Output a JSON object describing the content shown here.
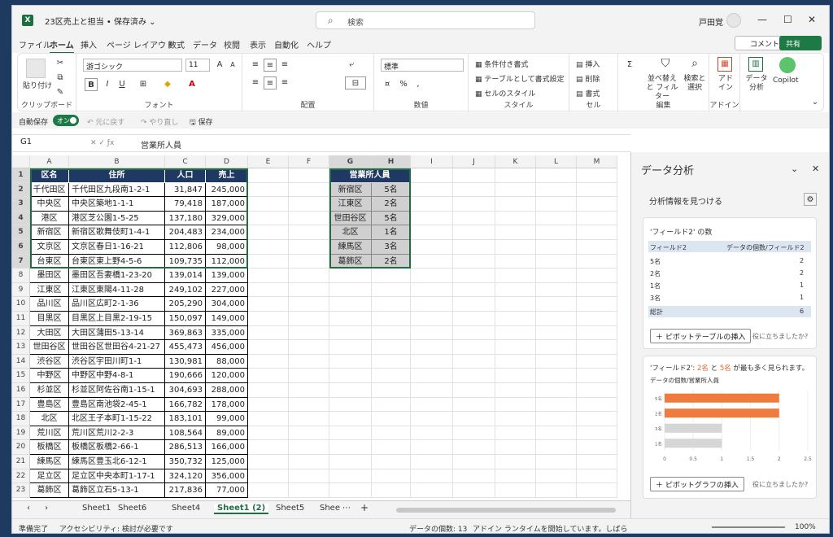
{
  "titlebar": {
    "app_icon": "X",
    "doc_title": "23区売上と担当 • 保存済み ⌄",
    "search": "検索",
    "user": "戸田覚"
  },
  "tabs": [
    "ファイル",
    "ホーム",
    "挿入",
    "ページ レイアウト",
    "数式",
    "データ",
    "校閲",
    "表示",
    "自動化",
    "ヘルプ"
  ],
  "comment": "コメント",
  "share": "共有",
  "ribbon": {
    "clipboard": "クリップボード",
    "paste": "貼り付け",
    "font": "フォント",
    "font_name": "游ゴシック",
    "font_size": "11",
    "align": "配置",
    "number": "数値",
    "number_format": "標準",
    "styles": "スタイル",
    "cond": "条件付き書式",
    "table": "テーブルとして書式設定",
    "cellstyle": "セルのスタイル",
    "cells": "セル",
    "insert": "挿入",
    "delete": "削除",
    "format": "書式",
    "edit": "編集",
    "sortfilter": "並べ替えと フィルター",
    "findsel": "検索と 選択",
    "addin": "アドイン",
    "addin_btn": "アド イン",
    "analyze": "データ 分析",
    "copilot": "Copilot"
  },
  "qat": {
    "autosave": "自動保存",
    "on": "オン",
    "undo": "元に戻す",
    "redo": "やり直し",
    "save": "保存"
  },
  "formula": {
    "namebox": "G1",
    "content": "営業所人員"
  },
  "columns": [
    "A",
    "B",
    "C",
    "D",
    "E",
    "F",
    "G",
    "H",
    "I",
    "J",
    "K",
    "L",
    "M"
  ],
  "table_header": [
    "区名",
    "住所",
    "人口",
    "売上"
  ],
  "rows": [
    [
      "千代田区",
      "千代田区九段南1-2-1",
      "31,847",
      "245,000"
    ],
    [
      "中央区",
      "中央区築地1-1-1",
      "79,418",
      "187,000"
    ],
    [
      "港区",
      "港区芝公園1-5-25",
      "137,180",
      "329,000"
    ],
    [
      "新宿区",
      "新宿区歌舞伎町1-4-1",
      "204,483",
      "234,000"
    ],
    [
      "文京区",
      "文京区春日1-16-21",
      "112,806",
      "98,000"
    ],
    [
      "台東区",
      "台東区東上野4-5-6",
      "109,735",
      "112,000"
    ],
    [
      "墨田区",
      "墨田区吾妻橋1-23-20",
      "139,014",
      "139,000"
    ],
    [
      "江東区",
      "江東区東陽4-11-28",
      "249,102",
      "227,000"
    ],
    [
      "品川区",
      "品川区広町2-1-36",
      "205,290",
      "304,000"
    ],
    [
      "目黒区",
      "目黒区上目黒2-19-15",
      "150,097",
      "149,000"
    ],
    [
      "大田区",
      "大田区蒲田5-13-14",
      "369,863",
      "335,000"
    ],
    [
      "世田谷区",
      "世田谷区世田谷4-21-27",
      "455,473",
      "456,000"
    ],
    [
      "渋谷区",
      "渋谷区宇田川町1-1",
      "130,981",
      "88,000"
    ],
    [
      "中野区",
      "中野区中野4-8-1",
      "190,666",
      "120,000"
    ],
    [
      "杉並区",
      "杉並区阿佐谷南1-15-1",
      "304,693",
      "288,000"
    ],
    [
      "豊島区",
      "豊島区南池袋2-45-1",
      "166,782",
      "178,000"
    ],
    [
      "北区",
      "北区王子本町1-15-22",
      "183,101",
      "99,000"
    ],
    [
      "荒川区",
      "荒川区荒川2-2-3",
      "108,564",
      "89,000"
    ],
    [
      "板橋区",
      "板橋区板橋2-66-1",
      "286,513",
      "166,000"
    ],
    [
      "練馬区",
      "練馬区豊玉北6-12-1",
      "350,732",
      "125,000"
    ],
    [
      "足立区",
      "足立区中央本町1-17-1",
      "324,120",
      "356,000"
    ],
    [
      "葛飾区",
      "葛飾区立石5-13-1",
      "217,836",
      "77,000"
    ]
  ],
  "side_header": "営業所人員",
  "side_rows": [
    [
      "新宿区",
      "5名"
    ],
    [
      "江東区",
      "2名"
    ],
    [
      "世田谷区",
      "5名"
    ],
    [
      "北区",
      "1名"
    ],
    [
      "練馬区",
      "3名"
    ],
    [
      "葛飾区",
      "2名"
    ]
  ],
  "sheets": [
    "Sheet1",
    "Sheet6",
    "Sheet4",
    "Sheet1 (2)",
    "Sheet5",
    "Shee"
  ],
  "status": {
    "ready": "準備完了",
    "access": "アクセシビリティ: 検討が必要です",
    "count": "データの個数: 13",
    "addin": "アドイン ランタイムを開始しています。しばらくお待ちください...",
    "zoom": "100%"
  },
  "panel": {
    "title": "データ分析",
    "find": "分析情報を見つける",
    "card1_title": "'フィールド2' の数",
    "col_a": "フィールド2",
    "col_b": "データの個数/フィールド2",
    "pivot_rows": [
      [
        "5名",
        "2"
      ],
      [
        "2名",
        "2"
      ],
      [
        "1名",
        "1"
      ],
      [
        "3名",
        "1"
      ]
    ],
    "total_label": "総計",
    "total_value": "6",
    "pivot_btn": "ピボットテーブルの挿入",
    "helpful": "役に立ちましたか?",
    "card2_title_a": "'フィールド2': ",
    "card2_hl1": "2名",
    "card2_mid": " と ",
    "card2_hl2": "5名",
    "card2_title_b": " が最も多く見られます。",
    "chart_title": "データの個数/営業所人員",
    "chart_btn": "ピボットグラフの挿入",
    "helpful2": "役に立ちましたか?"
  },
  "chart_data": {
    "type": "bar",
    "categories": [
      "5名",
      "2名",
      "3名",
      "1名"
    ],
    "values": [
      2,
      2,
      1,
      1
    ],
    "xlim": [
      0,
      2.5
    ],
    "ticks": [
      "0",
      "0.5",
      "1",
      "1.5",
      "2",
      "2.5"
    ],
    "colors": [
      "#f07b3f",
      "#f07b3f",
      "#d6d6d6",
      "#d6d6d6"
    ]
  }
}
